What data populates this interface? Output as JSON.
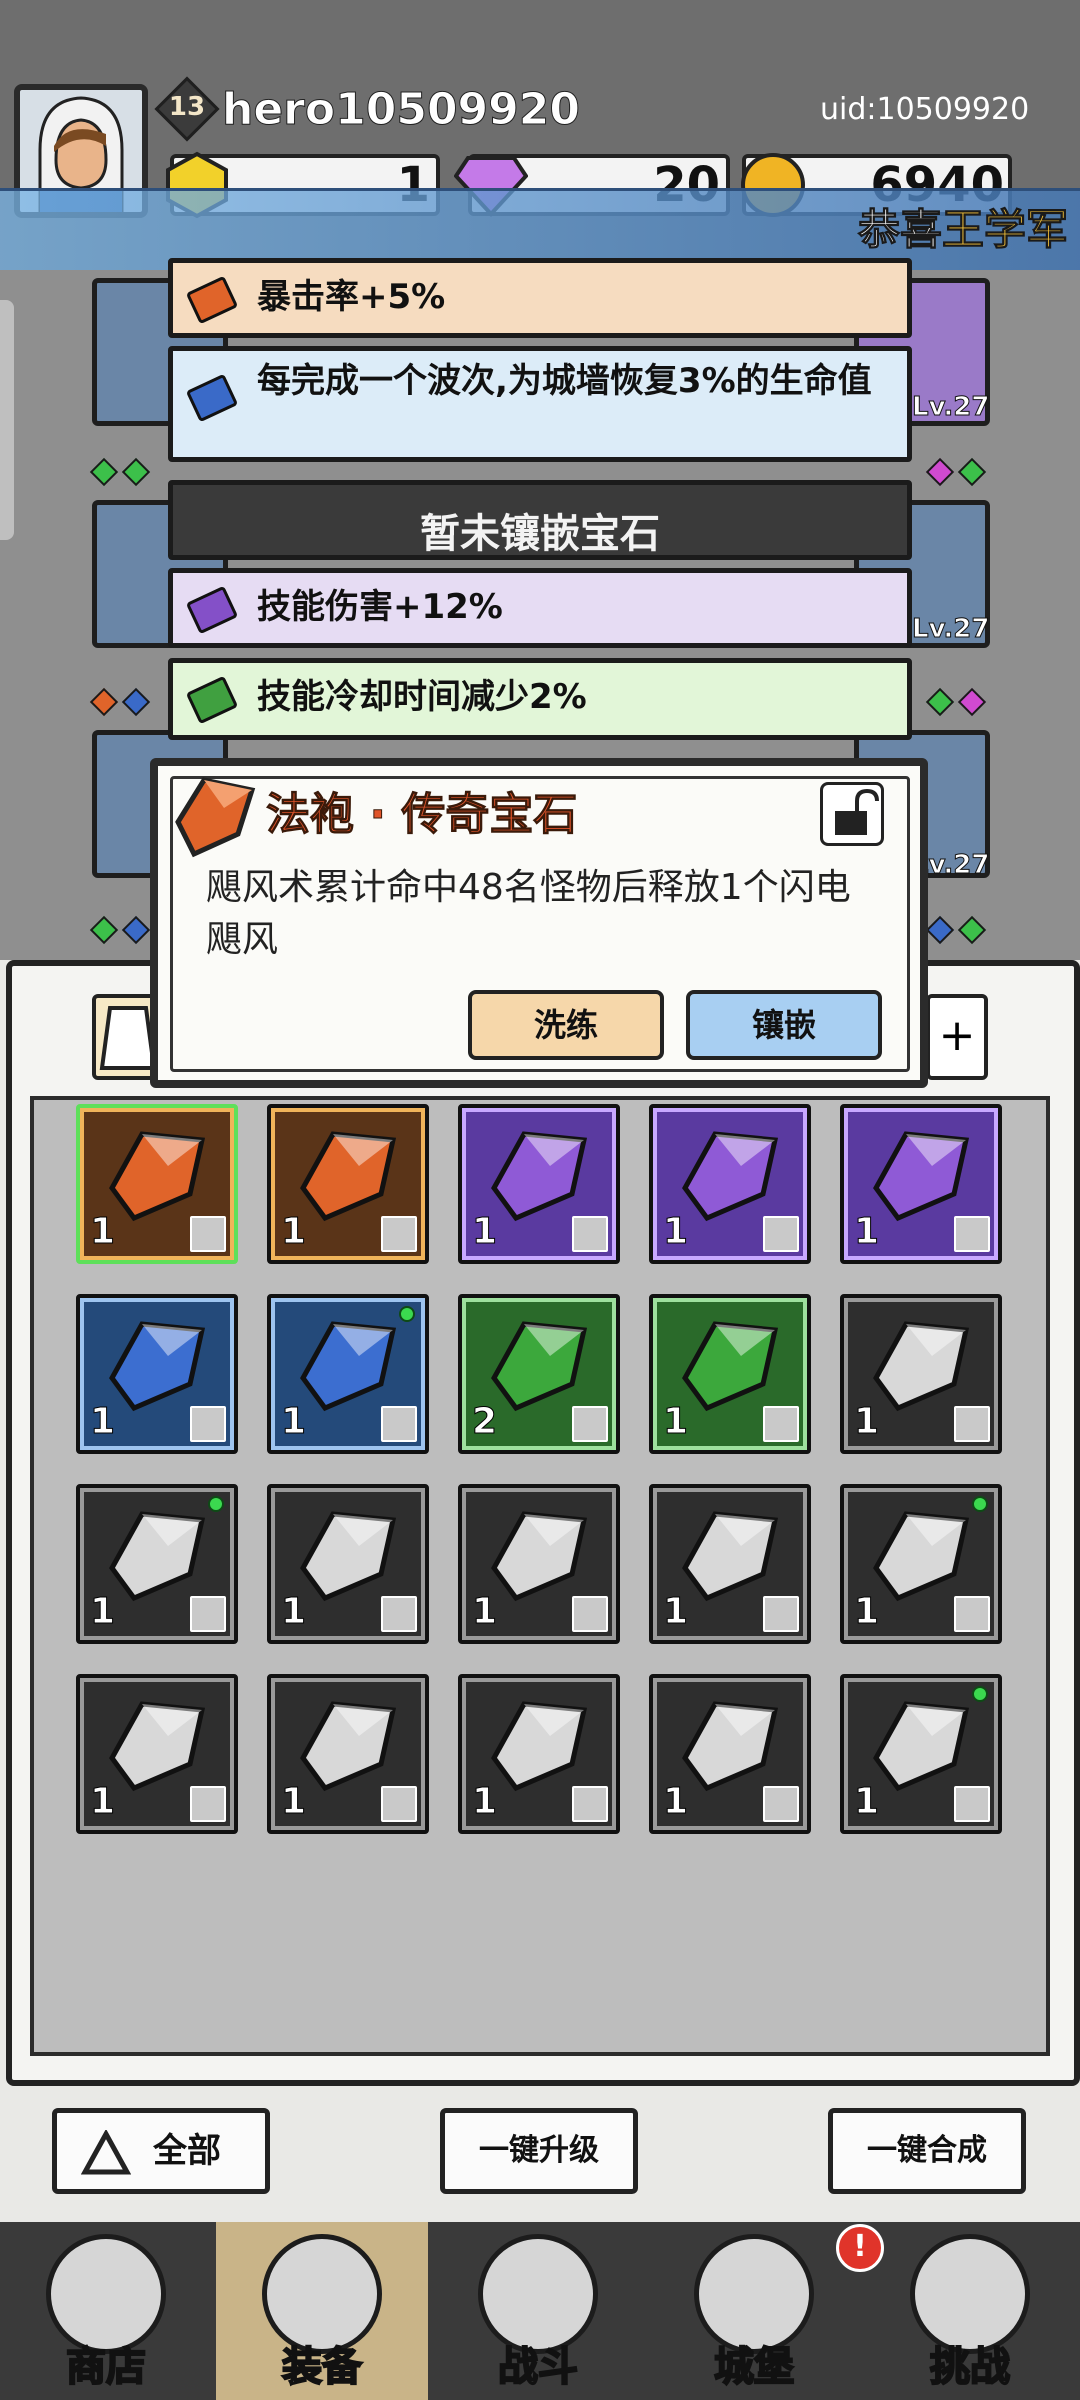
{
  "header": {
    "level": "13",
    "username": "hero10509920",
    "uid": "uid:10509920",
    "resources": [
      {
        "name": "gold-gem",
        "value": "1"
      },
      {
        "name": "diamond",
        "value": "20"
      },
      {
        "name": "coin",
        "value": "6940"
      }
    ],
    "notice_prefix": "恭喜",
    "notice_name": "王学军"
  },
  "equipment_levels": [
    "Lv.27",
    "Lv.27",
    "Lv.27"
  ],
  "gem_stats": [
    {
      "text": "暴击率+5%",
      "color": "#f6dcc0",
      "gem": "#e0642a"
    },
    {
      "text": "每完成一个波次,为城墙恢复3%的生命值",
      "color": "#dcecf8",
      "gem": "#3a6ac8"
    },
    {
      "text": "暂未镶嵌宝石",
      "color": "#3a3a3a",
      "gem": ""
    },
    {
      "text": "技能伤害+12%",
      "color": "#e6dcf3",
      "gem": "#8450c8"
    },
    {
      "text": "技能冷却时间减少2%",
      "color": "#e2f6d8",
      "gem": "#40a040"
    }
  ],
  "popup": {
    "title": "法袍 · 传奇宝石",
    "description": "飓风术累计命中48名怪物后释放1个闪电飓风",
    "reroll_label": "洗练",
    "inlay_label": "镶嵌"
  },
  "inventory": {
    "rows": [
      [
        {
          "count": "1",
          "gem": "#e0642a",
          "bg": "#5a3418",
          "border": "#f0b45a",
          "selected": true,
          "dot": false
        },
        {
          "count": "1",
          "gem": "#e0642a",
          "bg": "#5a3418",
          "border": "#f0b45a",
          "selected": false,
          "dot": false
        },
        {
          "count": "1",
          "gem": "#8f5ad6",
          "bg": "#5a3aa0",
          "border": "#c8a8ff",
          "selected": false,
          "dot": false
        },
        {
          "count": "1",
          "gem": "#8f5ad6",
          "bg": "#5a3aa0",
          "border": "#c8a8ff",
          "selected": false,
          "dot": false
        },
        {
          "count": "1",
          "gem": "#8f5ad6",
          "bg": "#5a3aa0",
          "border": "#c8a8ff",
          "selected": false,
          "dot": false
        }
      ],
      [
        {
          "count": "1",
          "gem": "#3c6ed0",
          "bg": "#244a7a",
          "border": "#9ec4ef",
          "selected": false,
          "dot": false
        },
        {
          "count": "1",
          "gem": "#3c6ed0",
          "bg": "#244a7a",
          "border": "#9ec4ef",
          "selected": false,
          "dot": true
        },
        {
          "count": "2",
          "gem": "#3ca83c",
          "bg": "#2a6a2a",
          "border": "#9ee09e",
          "selected": false,
          "dot": false
        },
        {
          "count": "1",
          "gem": "#3ca83c",
          "bg": "#2a6a2a",
          "border": "#9ee09e",
          "selected": false,
          "dot": false
        },
        {
          "count": "1",
          "gem": "#d8d8d8",
          "bg": "#2e2e2e",
          "border": "#9a9a9a",
          "selected": false,
          "dot": false
        }
      ],
      [
        {
          "count": "1",
          "gem": "#d8d8d8",
          "bg": "#2e2e2e",
          "border": "#9a9a9a",
          "selected": false,
          "dot": true
        },
        {
          "count": "1",
          "gem": "#d8d8d8",
          "bg": "#2e2e2e",
          "border": "#9a9a9a",
          "selected": false,
          "dot": false
        },
        {
          "count": "1",
          "gem": "#d8d8d8",
          "bg": "#2e2e2e",
          "border": "#9a9a9a",
          "selected": false,
          "dot": false
        },
        {
          "count": "1",
          "gem": "#d8d8d8",
          "bg": "#2e2e2e",
          "border": "#9a9a9a",
          "selected": false,
          "dot": false
        },
        {
          "count": "1",
          "gem": "#d8d8d8",
          "bg": "#2e2e2e",
          "border": "#9a9a9a",
          "selected": false,
          "dot": true
        }
      ],
      [
        {
          "count": "1",
          "gem": "#d8d8d8",
          "bg": "#2e2e2e",
          "border": "#9a9a9a",
          "selected": false,
          "dot": false
        },
        {
          "count": "1",
          "gem": "#d8d8d8",
          "bg": "#2e2e2e",
          "border": "#9a9a9a",
          "selected": false,
          "dot": false
        },
        {
          "count": "1",
          "gem": "#d8d8d8",
          "bg": "#2e2e2e",
          "border": "#9a9a9a",
          "selected": false,
          "dot": false
        },
        {
          "count": "1",
          "gem": "#d8d8d8",
          "bg": "#2e2e2e",
          "border": "#9a9a9a",
          "selected": false,
          "dot": false
        },
        {
          "count": "1",
          "gem": "#d8d8d8",
          "bg": "#2e2e2e",
          "border": "#9a9a9a",
          "selected": false,
          "dot": true
        }
      ]
    ]
  },
  "actions": {
    "filter_label": "全部",
    "upgrade_all": "一键升级",
    "merge_all": "一键合成"
  },
  "nav": [
    {
      "label": "商店",
      "icon": "shop-icon",
      "active": false
    },
    {
      "label": "装备",
      "icon": "backpack-icon",
      "active": true
    },
    {
      "label": "战斗",
      "icon": "crossed-swords-icon",
      "active": false
    },
    {
      "label": "城堡",
      "icon": "castle-icon",
      "active": false
    },
    {
      "label": "挑战",
      "icon": "shield-icon",
      "active": false
    }
  ],
  "nav_alert": "!"
}
